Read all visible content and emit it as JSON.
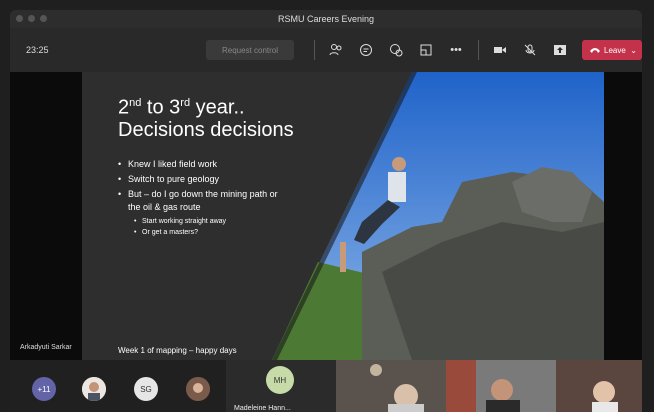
{
  "window": {
    "title": "RSMU Careers Evening"
  },
  "toolbar": {
    "time": "23:25",
    "request_control": "Request control",
    "more": "•••",
    "leave": "Leave"
  },
  "slide": {
    "title_line1_a": "2",
    "title_line1_sup1": "nd",
    "title_line1_b": " to 3",
    "title_line1_sup2": "rd",
    "title_line1_c": " year..",
    "title_line2": "Decisions decisions",
    "bullets": [
      "Knew I liked field work",
      "Switch to pure geology",
      "But – do I go down the mining path or the oil & gas route"
    ],
    "sub_bullets": [
      "Start working straight away",
      "Or get a masters?"
    ],
    "caption": "Week 1 of mapping – happy days"
  },
  "presenter": "Arkadyuti Sarkar",
  "gallery": {
    "overflow_count": "+11",
    "initials_sg": "SG",
    "initials_mh": "MH",
    "mh_name": "Madeleine Hann..."
  },
  "colors": {
    "leave": "#c4314b",
    "accent_purple": "#6264a7"
  }
}
